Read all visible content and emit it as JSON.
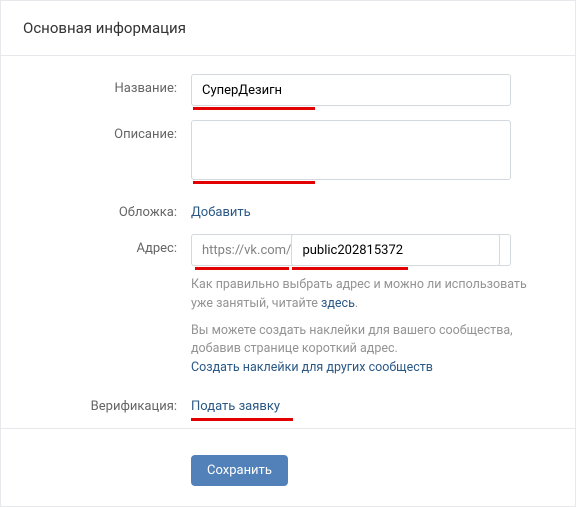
{
  "header": {
    "title": "Основная информация"
  },
  "form": {
    "name": {
      "label": "Название:",
      "value": "СуперДезигн"
    },
    "description": {
      "label": "Описание:",
      "value": ""
    },
    "cover": {
      "label": "Обложка:",
      "link": "Добавить"
    },
    "address": {
      "label": "Адрес:",
      "prefix": "https://vk.com/",
      "value": "public202815372",
      "help1_pre": "Как правильно выбрать адрес и можно ли использовать уже занятый, читайте ",
      "help1_link": "здесь",
      "help1_post": ".",
      "help2": "Вы можете создать наклейки для вашего сообщества, добавив странице короткий адрес.",
      "help2_link": "Создать наклейки для других сообществ"
    },
    "verification": {
      "label": "Верификация:",
      "link": "Подать заявку"
    }
  },
  "footer": {
    "save": "Сохранить"
  }
}
